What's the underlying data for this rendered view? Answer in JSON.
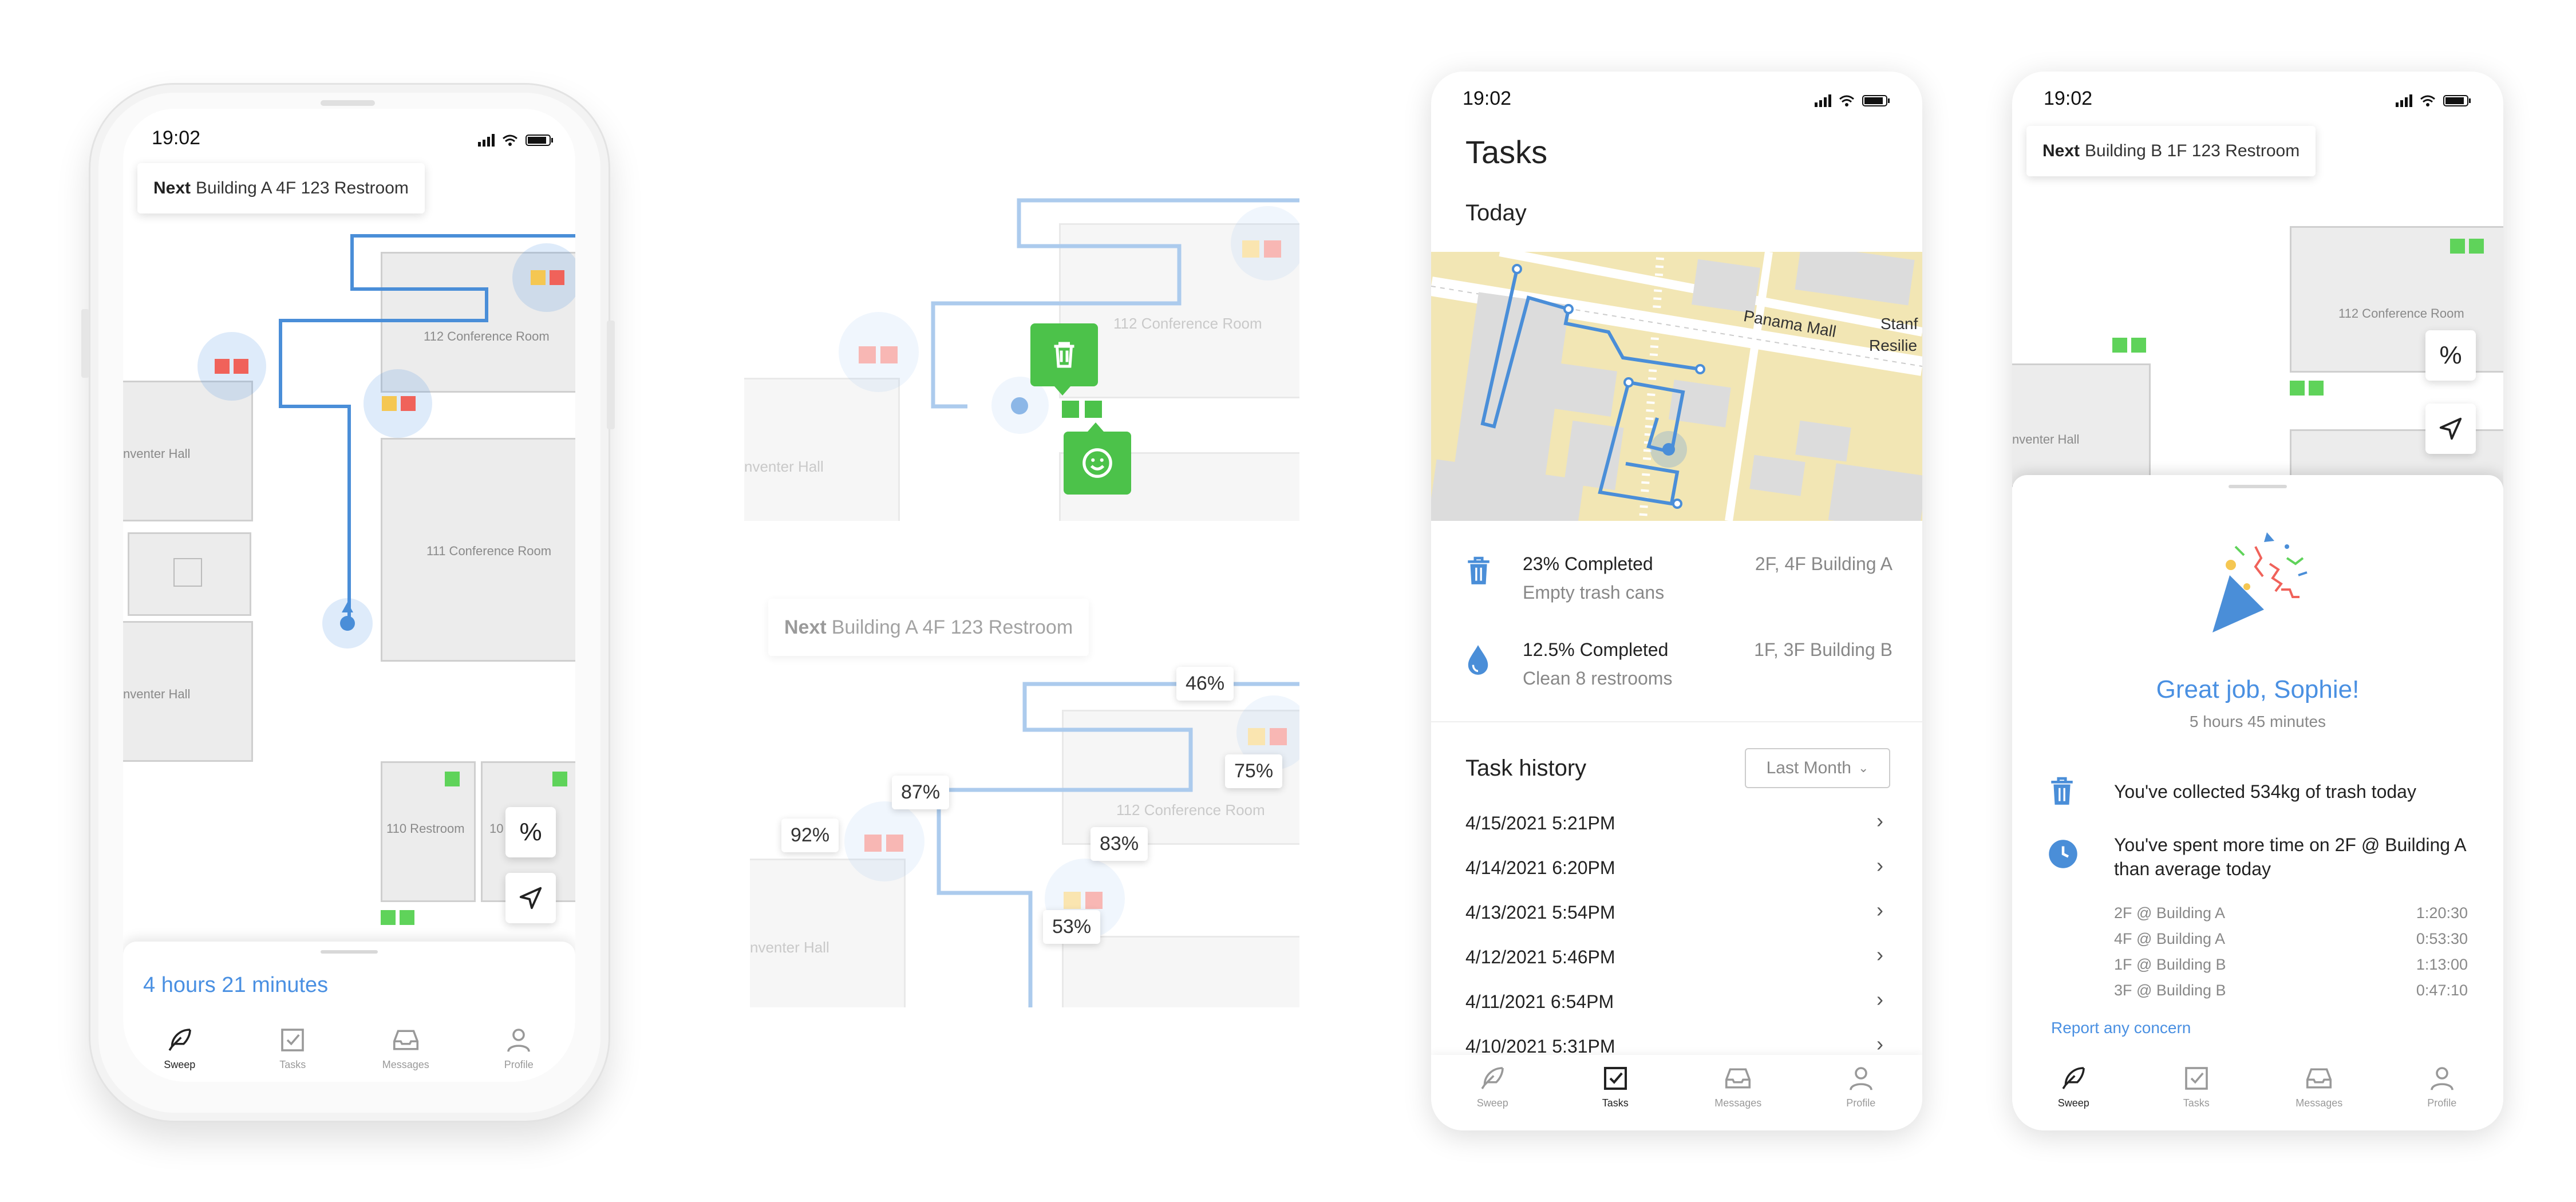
{
  "status_time": "19:02",
  "screen1": {
    "next_prefix": "Next",
    "next_text": "Building A 4F 123 Restroom",
    "rooms": {
      "conf112": "112 Conference Room",
      "conf111": "111 Conference Room",
      "hall1": "nventer Hall",
      "hall2": "nventer Hall",
      "rest110": "110 Restroom",
      "rest10x": "10"
    },
    "elapsed": "4 hours 21 minutes",
    "percent_icon": "%"
  },
  "tabs": [
    "Sweep",
    "Tasks",
    "Messages",
    "Profile"
  ],
  "icons": {
    "sweep": "feather-icon",
    "tasks": "checkbox-icon",
    "messages": "inbox-icon",
    "profile": "person-icon"
  },
  "map_detail": {
    "rooms": {
      "conf112": "112 Conference Room",
      "hall": "nventer Hall"
    }
  },
  "map_percent": {
    "next_prefix": "Next",
    "next_text": "Building A 4F 123 Restroom",
    "labels": {
      "p46": "46%",
      "p87": "87%",
      "p75": "75%",
      "p92": "92%",
      "p83": "83%",
      "p53": "53%"
    },
    "rooms": {
      "conf112": "112 Conference Room",
      "hall": "nventer Hall"
    }
  },
  "tasks_screen": {
    "title": "Tasks",
    "today": "Today",
    "map_labels": {
      "mall": "Panama Mall",
      "stan": "Stanf",
      "resil": "Resilie"
    },
    "items": [
      {
        "title": "23% Completed",
        "subtitle": "Empty trash cans",
        "location": "2F, 4F Building A"
      },
      {
        "title": "12.5% Completed",
        "subtitle": "Clean 8 restrooms",
        "location": "1F, 3F Building B"
      }
    ],
    "history_title": "Task history",
    "filter": "Last Month",
    "history": [
      "4/15/2021 5:21PM",
      "4/14/2021 6:20PM",
      "4/13/2021 5:54PM",
      "4/12/2021 5:46PM",
      "4/11/2021 6:54PM",
      "4/10/2021 5:31PM"
    ]
  },
  "done_screen": {
    "next_prefix": "Next",
    "next_text": "Building B 1F 123 Restroom",
    "room": "112 Conference Room",
    "hall": "nventer Hall",
    "greeting": "Great job, Sophie!",
    "duration": "5 hours 45 minutes",
    "stat1": "You've collected 534kg of trash today",
    "stat2": "You've spent more time on 2F @ Building A than average today",
    "breakdown": [
      {
        "place": "2F @ Building A",
        "time": "1:20:30"
      },
      {
        "place": "4F @ Building A",
        "time": "0:53:30"
      },
      {
        "place": "1F @ Building B",
        "time": "1:13:00"
      },
      {
        "place": "3F @ Building B",
        "time": "0:47:10"
      }
    ],
    "report": "Report any concern"
  },
  "colors": {
    "accent": "#4a90e2",
    "green": "#5fd35a",
    "red": "#f0625a",
    "yellow": "#f5c752",
    "trash_green": "#4cc24a"
  }
}
